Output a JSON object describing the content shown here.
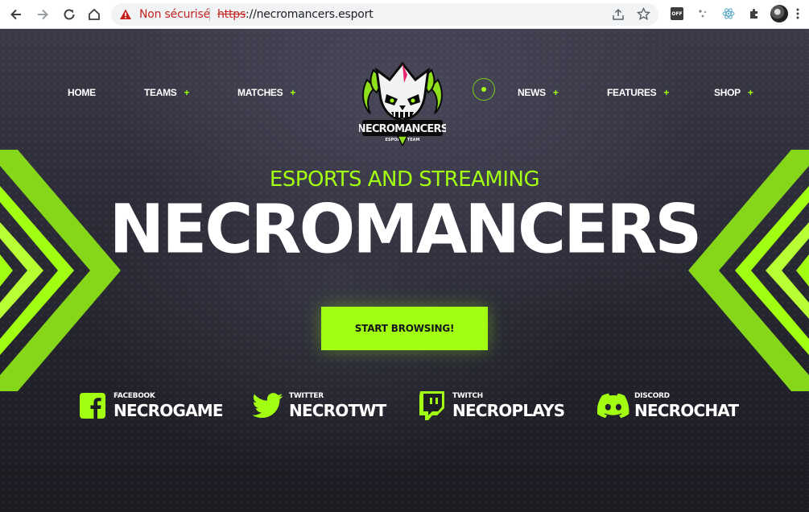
{
  "browser": {
    "security_warning": "Non sécurisé",
    "url_scheme": "https",
    "url_rest": "://necromancers.esport",
    "ext_off_label": "OFF"
  },
  "nav": {
    "left": [
      {
        "label": "HOME",
        "has_plus": false
      },
      {
        "label": "TEAMS",
        "has_plus": true
      },
      {
        "label": "MATCHES",
        "has_plus": true
      }
    ],
    "right": [
      {
        "label": "NEWS",
        "has_plus": true
      },
      {
        "label": "FEATURES",
        "has_plus": true
      },
      {
        "label": "SHOP",
        "has_plus": true
      }
    ],
    "plus_symbol": "+"
  },
  "logo": {
    "name": "NECROMANCERS",
    "tagline": "ESPORTS TEAM"
  },
  "hero": {
    "subtitle": "ESPORTS AND STREAMING",
    "title": "NECROMANCERS",
    "cta_label": "START BROWSING!"
  },
  "socials": [
    {
      "platform": "FACEBOOK",
      "handle": "NECROGAME",
      "icon": "facebook-icon"
    },
    {
      "platform": "TWITTER",
      "handle": "NECROTWT",
      "icon": "twitter-icon"
    },
    {
      "platform": "TWITCH",
      "handle": "NECROPLAYS",
      "icon": "twitch-icon"
    },
    {
      "platform": "DISCORD",
      "handle": "NECROCHAT",
      "icon": "discord-icon"
    }
  ],
  "colors": {
    "accent": "#a3ff12",
    "background": "#1e1e26",
    "text": "#ffffff",
    "warning": "#c5221f"
  }
}
